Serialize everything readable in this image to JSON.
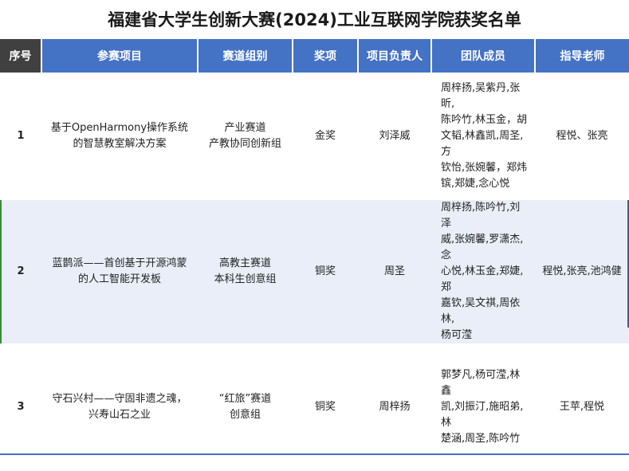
{
  "title": "福建省大学生创新大赛(2024)工业互联网学院获奖名单",
  "table": {
    "headers": [
      "序号",
      "参赛项目",
      "赛道组别",
      "奖项",
      "项目负责人",
      "团队成员",
      "指导老师"
    ],
    "rows": [
      {
        "seq": "1",
        "project_line1": "基于OpenHarmony操作系统",
        "project_line2": "的智慧教室解决方案",
        "track_line1": "产业赛道",
        "track_line2": "产教协同创新组",
        "award": "金奖",
        "leader": "刘泽威",
        "members_lines": [
          "周梓扬,吴紫丹,张昕,",
          "陈吟竹,林玉金，胡",
          "文韬,林鑫凯,周圣,方",
          "钦怡,张婉馨，郑炜",
          "镔,郑婕,念心悦"
        ],
        "mentor": "程悦、张亮"
      },
      {
        "seq": "2",
        "project_line1": "蓝鹊派——首创基于开源鸿蒙",
        "project_line2": "的人工智能开发板",
        "track_line1": "高教主赛道",
        "track_line2": "本科生创意组",
        "award": "铜奖",
        "leader": "周圣",
        "members_lines": [
          "周梓扬,陈吟竹,刘泽",
          "威,张婉馨,罗潇杰,念",
          "心悦,林玉金,郑婕,郑",
          "嘉钦,吴文祺,周依林,",
          "杨可滢"
        ],
        "mentor": "程悦,张亮,池鸿健"
      },
      {
        "seq": "3",
        "project_line1": "守石兴村——守固非遗之魂，",
        "project_line2": "兴寿山石之业",
        "track_line1": "“红旅”赛道",
        "track_line2": "创意组",
        "award": "铜奖",
        "leader": "周梓扬",
        "members_lines": [
          "郭梦凡,杨可滢,林鑫",
          "凯,刘振汀,施昭弟,林",
          "楚涵,周圣,陈吟竹"
        ],
        "mentor": "王苹,程悦"
      }
    ]
  },
  "colors": {
    "header_blue": "#4472c4",
    "header_dark": "#404040",
    "row_alt": "#e9eef8"
  }
}
